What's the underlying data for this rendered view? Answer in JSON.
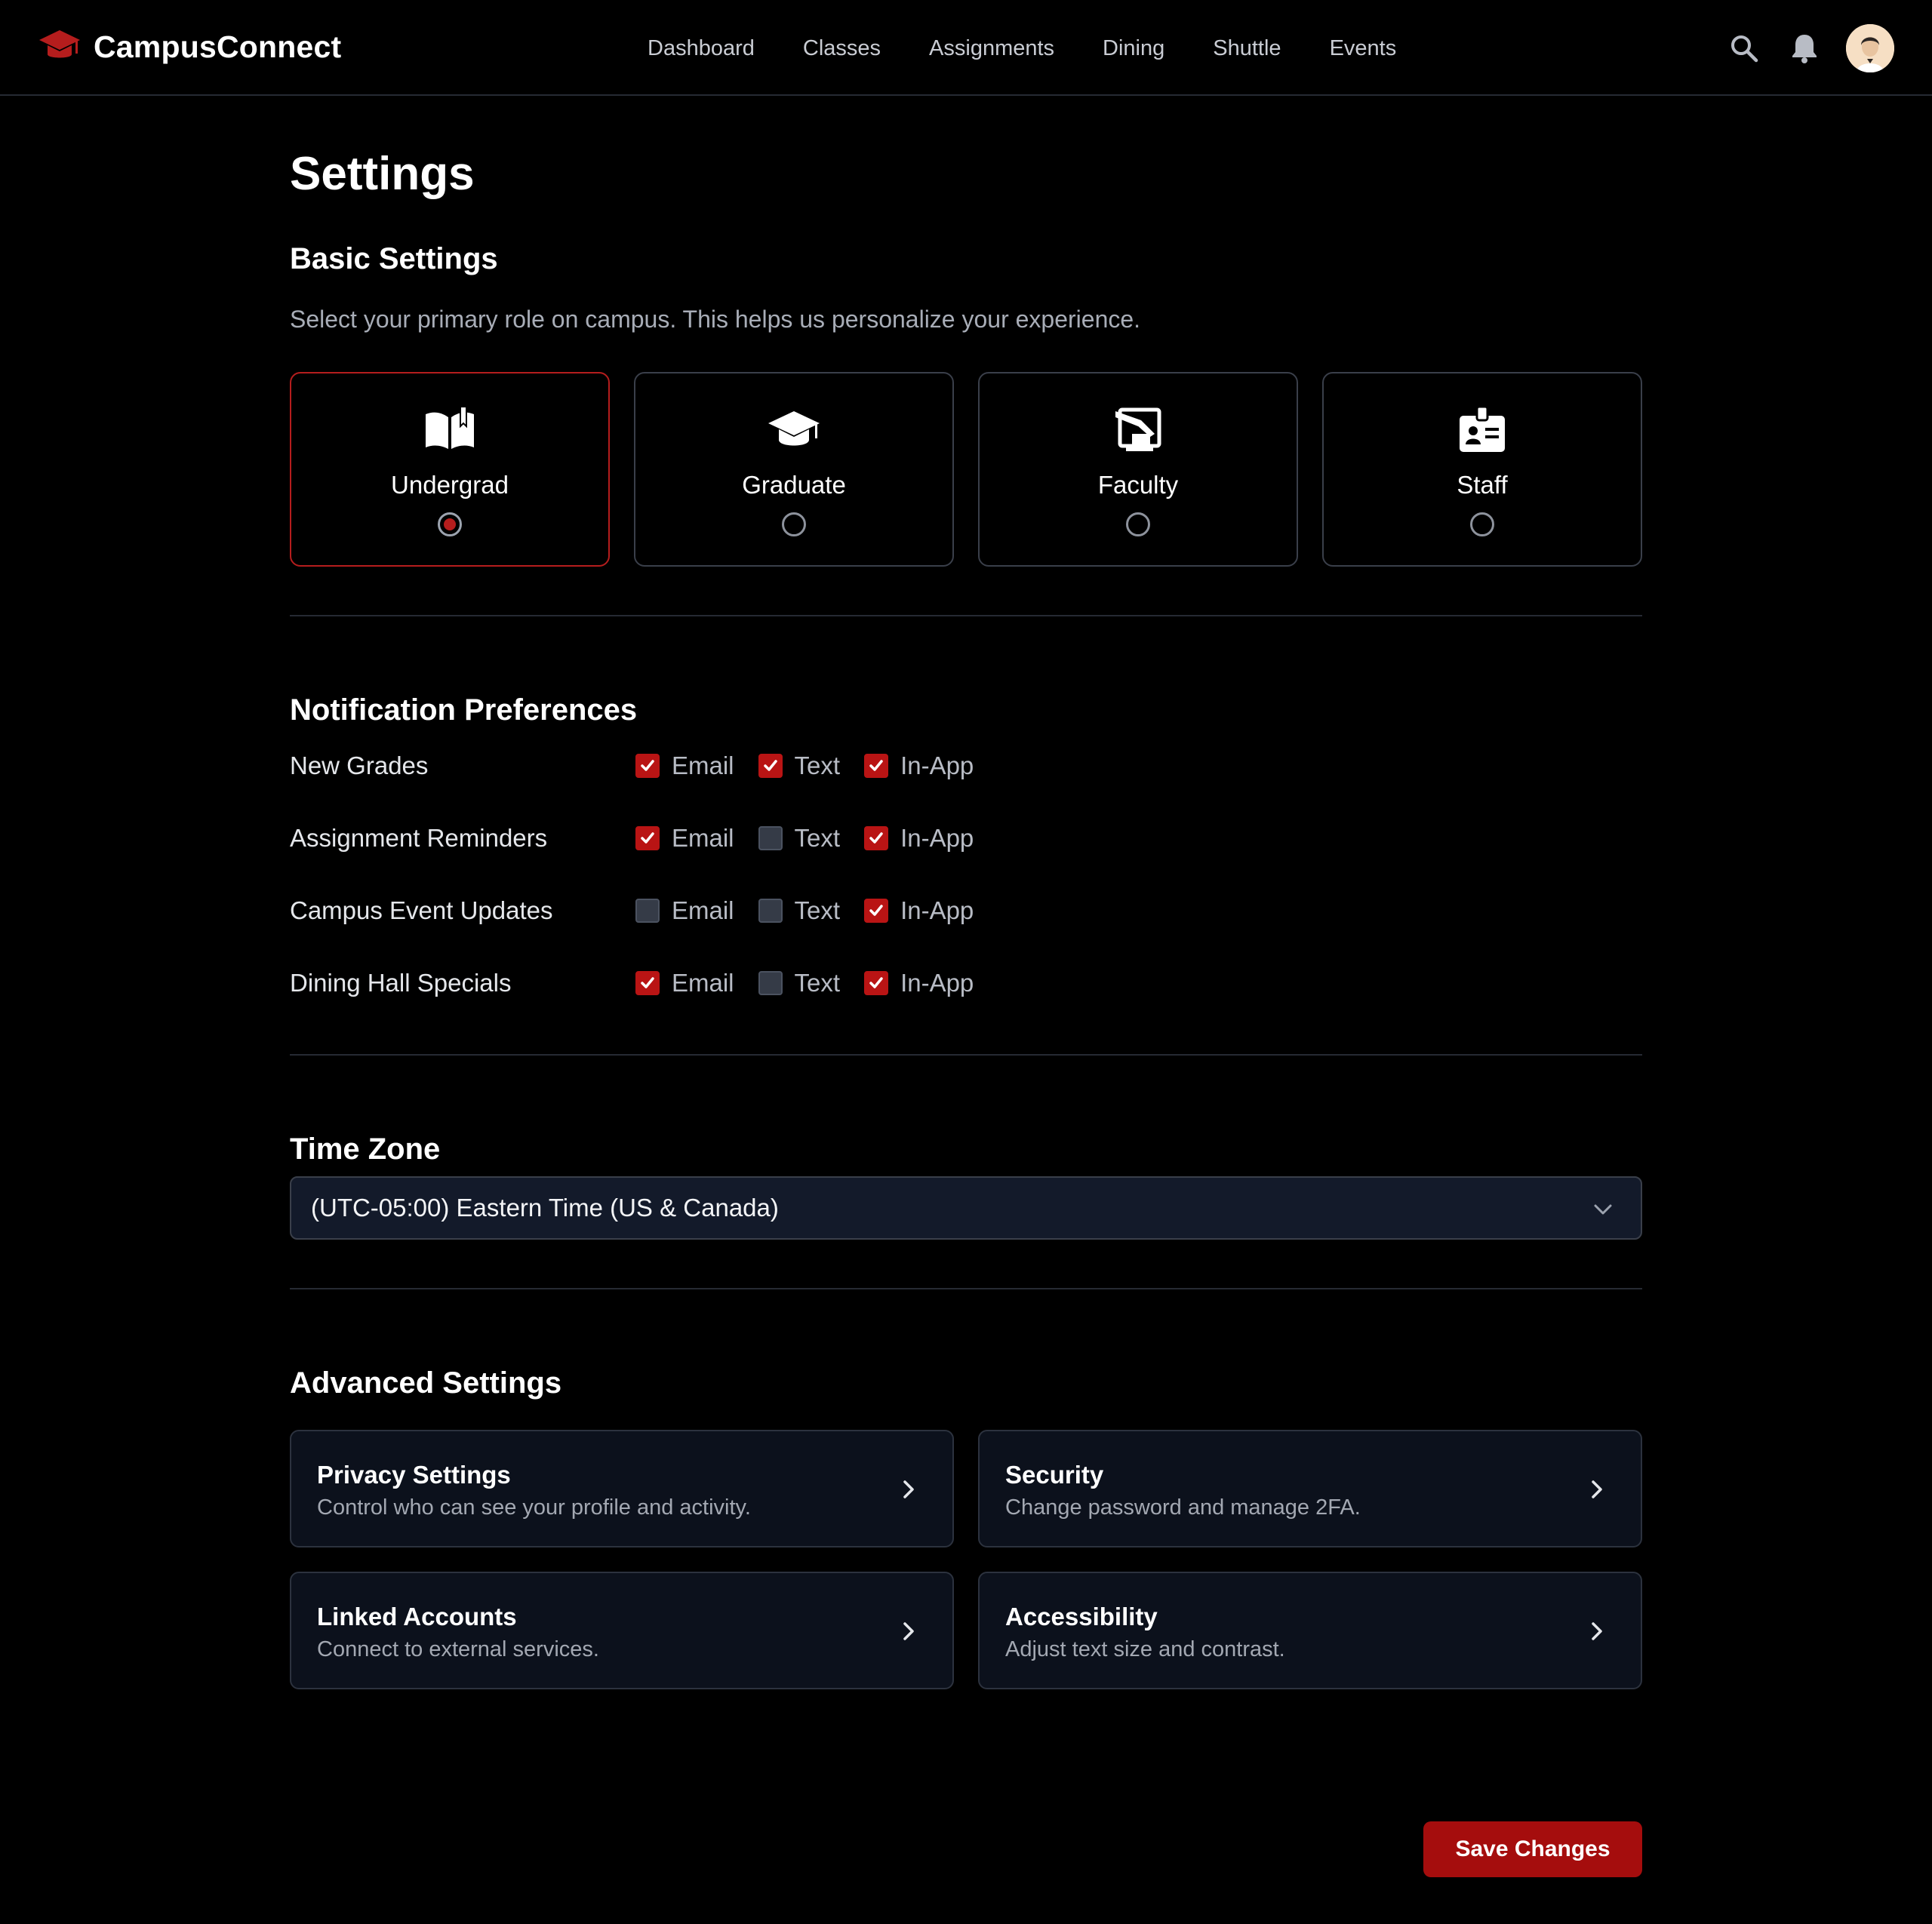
{
  "app": {
    "name": "CampusConnect",
    "accent": "#b51d1d"
  },
  "nav": {
    "items": [
      {
        "label": "Dashboard"
      },
      {
        "label": "Classes"
      },
      {
        "label": "Assignments"
      },
      {
        "label": "Dining"
      },
      {
        "label": "Shuttle"
      },
      {
        "label": "Events"
      }
    ]
  },
  "header_icons": [
    "search-icon",
    "bell-icon",
    "avatar"
  ],
  "page": {
    "title": "Settings"
  },
  "basic": {
    "title": "Basic Settings",
    "description": "Select your primary role on campus. This helps us personalize your experience.",
    "roles": [
      {
        "label": "Undergrad",
        "icon": "open-book-icon",
        "selected": true
      },
      {
        "label": "Graduate",
        "icon": "graduation-cap-icon",
        "selected": false
      },
      {
        "label": "Faculty",
        "icon": "chalkboard-teacher-icon",
        "selected": false
      },
      {
        "label": "Staff",
        "icon": "id-badge-icon",
        "selected": false
      }
    ]
  },
  "notifications": {
    "title": "Notification Preferences",
    "channels": [
      "Email",
      "Text",
      "In-App"
    ],
    "rows": [
      {
        "label": "New Grades",
        "email": true,
        "text": true,
        "inapp": true
      },
      {
        "label": "Assignment Reminders",
        "email": true,
        "text": false,
        "inapp": true
      },
      {
        "label": "Campus Event Updates",
        "email": false,
        "text": false,
        "inapp": true
      },
      {
        "label": "Dining Hall Specials",
        "email": true,
        "text": false,
        "inapp": true
      }
    ]
  },
  "timezone": {
    "title": "Time Zone",
    "value": "(UTC-05:00) Eastern Time (US & Canada)"
  },
  "advanced": {
    "title": "Advanced Settings",
    "cards": [
      {
        "title": "Privacy Settings",
        "subtitle": "Control who can see your profile and activity."
      },
      {
        "title": "Security",
        "subtitle": "Change password and manage 2FA."
      },
      {
        "title": "Linked Accounts",
        "subtitle": "Connect to external services."
      },
      {
        "title": "Accessibility",
        "subtitle": "Adjust text size and contrast."
      }
    ]
  },
  "actions": {
    "save_label": "Save Changes"
  }
}
